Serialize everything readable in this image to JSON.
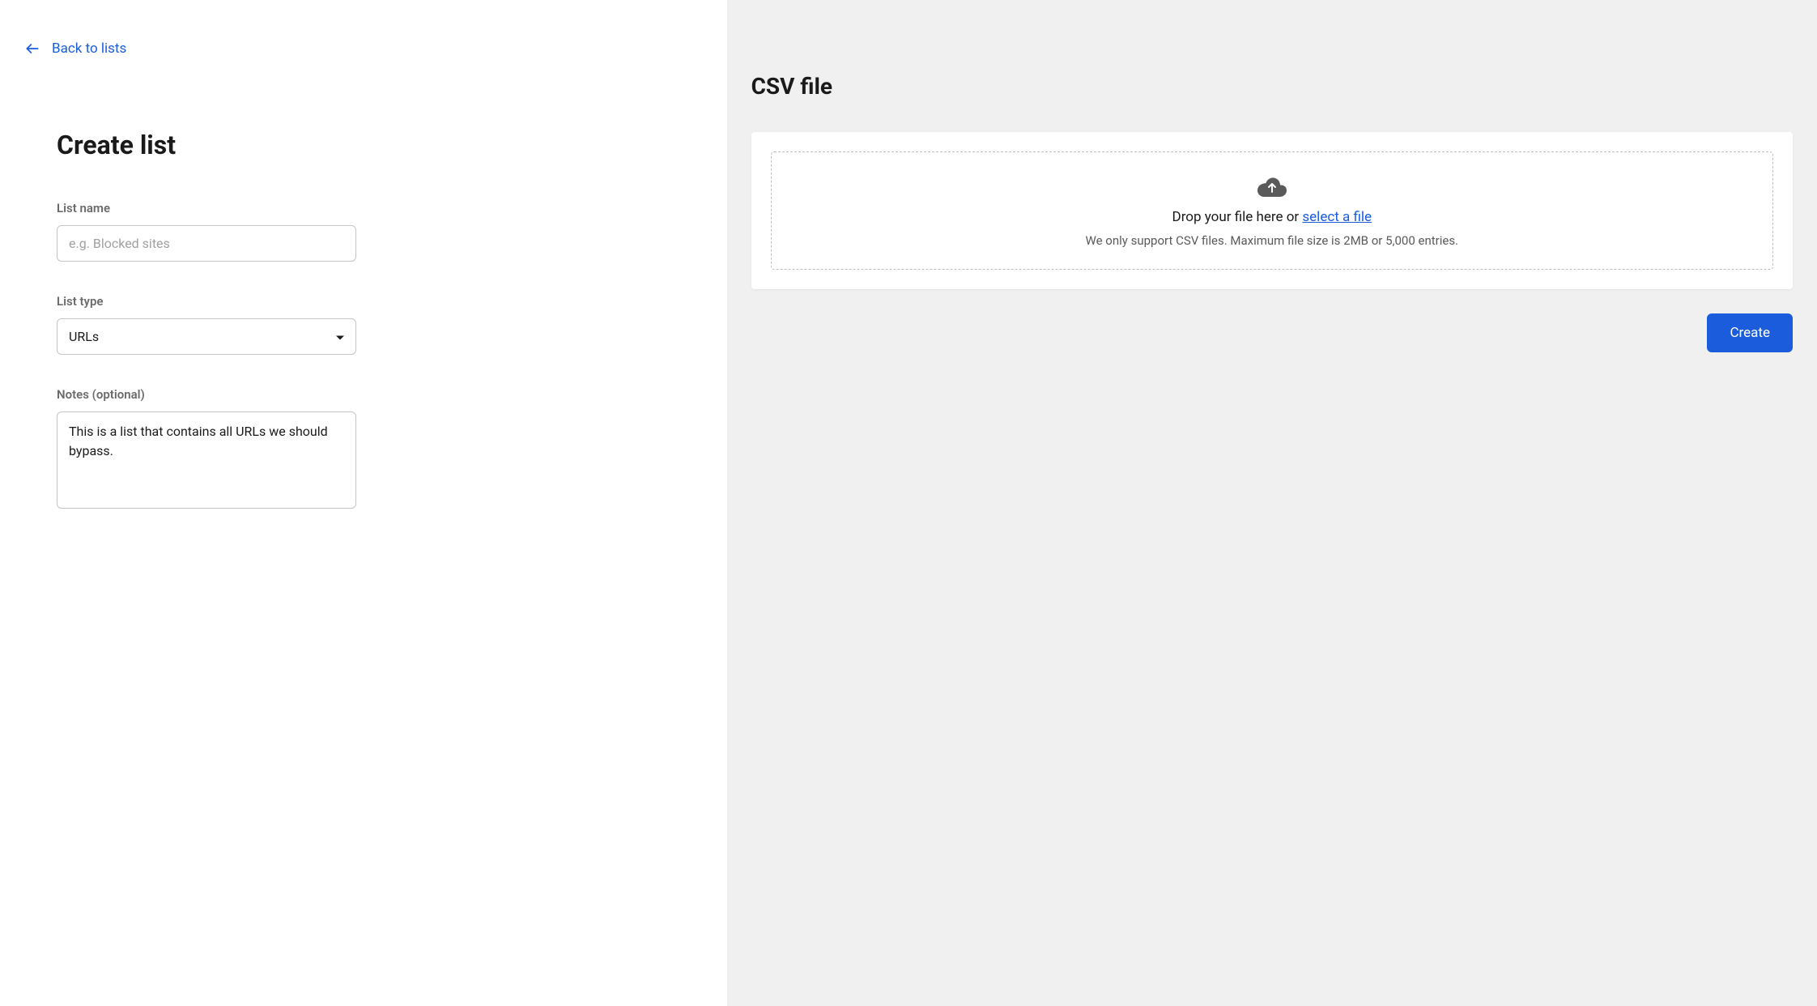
{
  "nav": {
    "back_label": "Back to lists"
  },
  "page": {
    "title": "Create list"
  },
  "form": {
    "list_name": {
      "label": "List name",
      "value": "",
      "placeholder": "e.g. Blocked sites"
    },
    "list_type": {
      "label": "List type",
      "value": "URLs"
    },
    "notes": {
      "label": "Notes (optional)",
      "value": "This is a list that contains all URLs we should bypass."
    }
  },
  "upload": {
    "title": "CSV file",
    "drop_prefix": "Drop your file here or ",
    "select_file": "select a file",
    "support_text": "We only support CSV files. Maximum file size is 2MB or 5,000 entries."
  },
  "actions": {
    "create": "Create"
  }
}
